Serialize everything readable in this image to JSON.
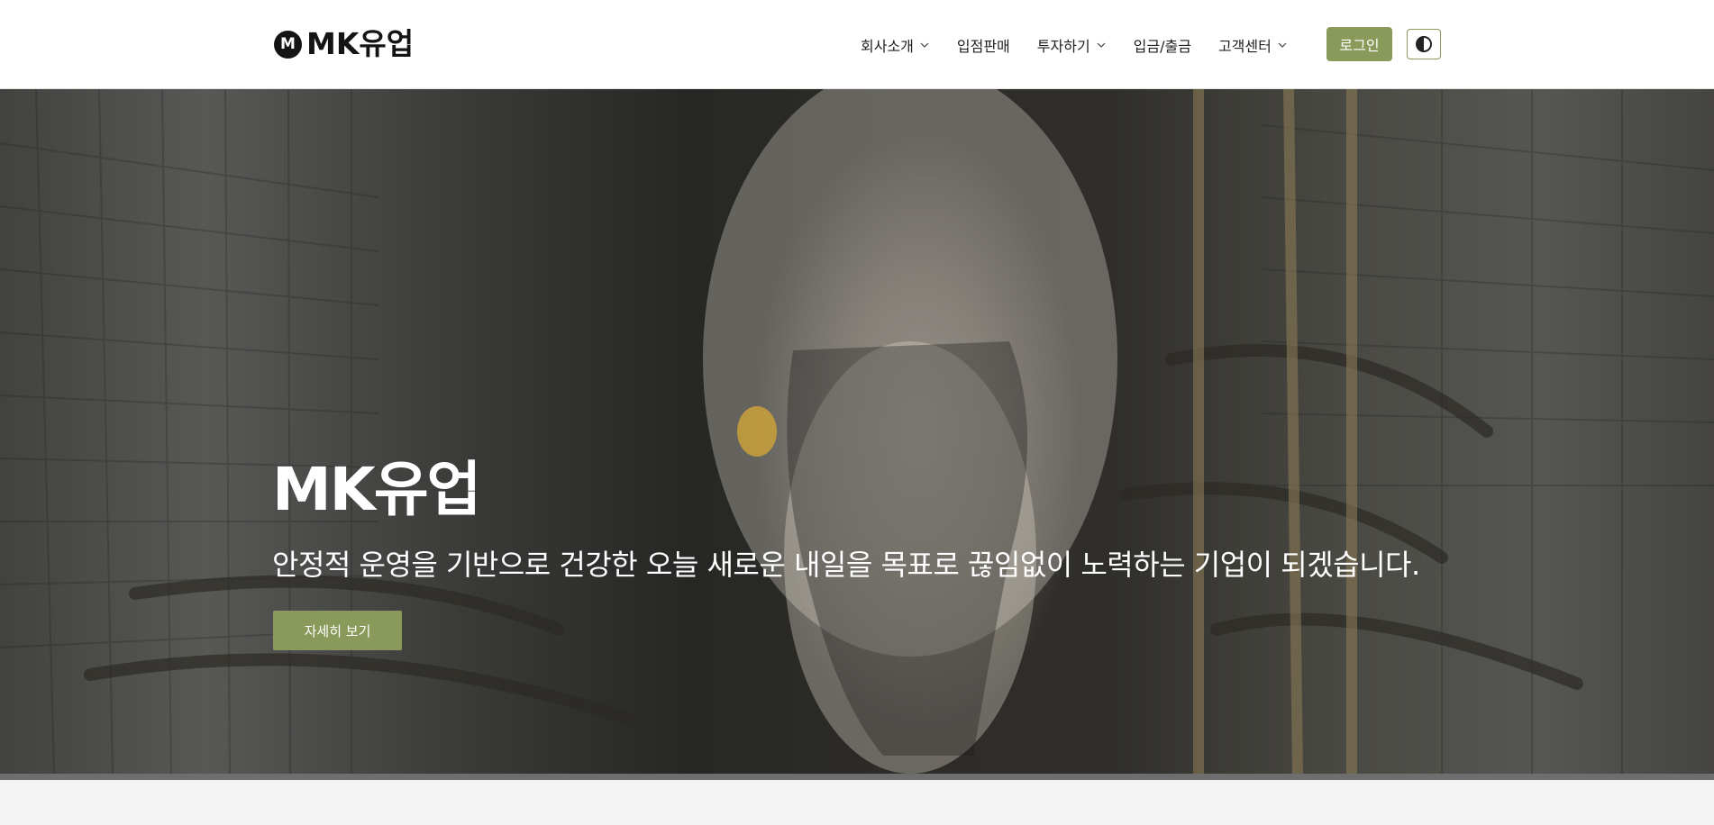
{
  "header": {
    "logo_badge": "M",
    "logo_text": "MK유업",
    "nav": [
      {
        "label": "회사소개",
        "has_dropdown": true
      },
      {
        "label": "입점판매",
        "has_dropdown": false
      },
      {
        "label": "투자하기",
        "has_dropdown": true
      },
      {
        "label": "입금/출금",
        "has_dropdown": false
      },
      {
        "label": "고객센터",
        "has_dropdown": true
      }
    ],
    "login_label": "로그인",
    "theme_toggle_icon": "contrast-icon"
  },
  "hero": {
    "title": "MK유업",
    "subtitle": "안정적 운영을 기반으로 건강한 오늘 새로운 내일을 목표로 끊임없이 노력하는 기업이 되겠습니다.",
    "cta_label": "자세히 보기"
  },
  "colors": {
    "accent": "#8a9a5b",
    "header_bg": "#ffffff",
    "text_dark": "#141414"
  }
}
